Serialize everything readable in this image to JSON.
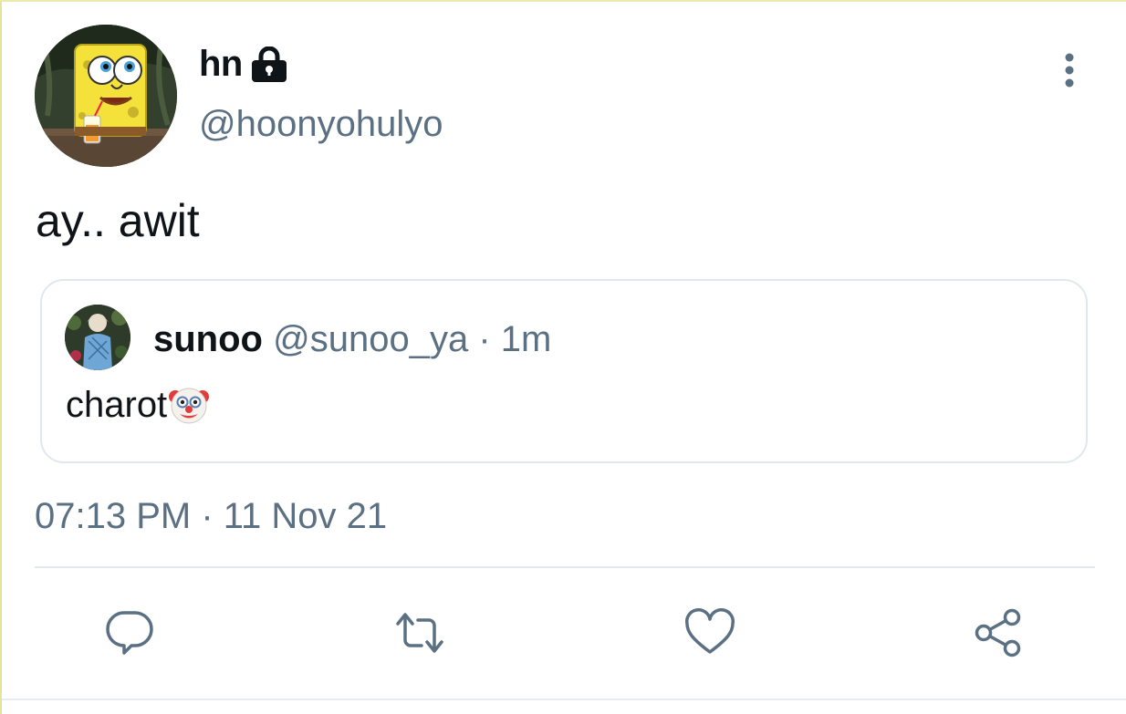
{
  "author": {
    "display_name": "hn",
    "handle": "@hoonyohulyo",
    "protected_icon": "lock-icon",
    "avatar": "spongebob-avatar"
  },
  "tweet": {
    "text": "ay.. awit",
    "timestamp": "07:13 PM · 11 Nov 21"
  },
  "quoted_tweet": {
    "display_name": "sunoo",
    "handle": "@sunoo_ya",
    "separator": " · ",
    "time": "1m",
    "text": "charot",
    "emoji_icon": "clown-face-icon"
  },
  "actions": [
    {
      "name": "reply",
      "icon": "reply-icon"
    },
    {
      "name": "retweet",
      "icon": "retweet-icon"
    },
    {
      "name": "like",
      "icon": "heart-icon"
    },
    {
      "name": "share",
      "icon": "share-icon"
    }
  ],
  "colors": {
    "text_primary": "#0f1419",
    "text_secondary": "#5b7083",
    "border": "#e1e8ed"
  }
}
